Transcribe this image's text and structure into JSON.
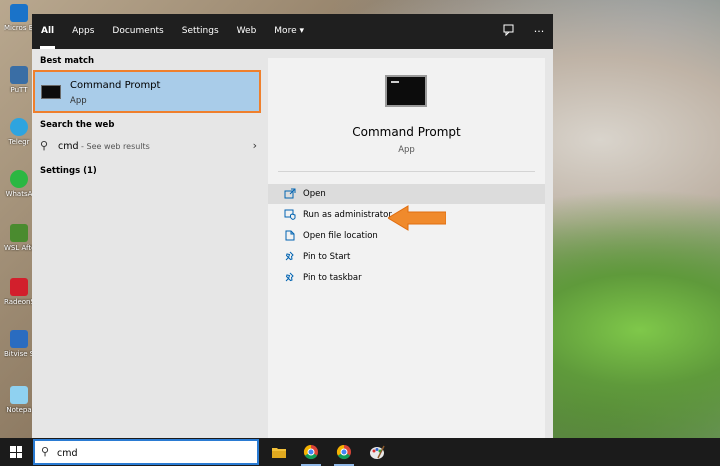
{
  "desktop_icons": [
    {
      "label": "Micros Edge",
      "color": "#1a73c9"
    },
    {
      "label": "PuTT",
      "color": "#3a6ea5"
    },
    {
      "label": "Telegr",
      "color": "#2ea4df"
    },
    {
      "label": "WhatsA",
      "color": "#2bb742"
    },
    {
      "label": "WSL Afterbu",
      "color": "#4a8b2f"
    },
    {
      "label": "RadeonS",
      "color": "#d21f2c"
    },
    {
      "label": "Bitvise SSH Client",
      "color": "#2a6cc0"
    },
    {
      "label": "Notepa",
      "color": "#8fd1f0"
    }
  ],
  "start": {
    "tabs": [
      "All",
      "Apps",
      "Documents",
      "Settings",
      "Web",
      "More ▾"
    ],
    "active_tab": "All",
    "topbar_icons": [
      "feedback-icon",
      "more-options-icon"
    ],
    "best_match_heading": "Best match",
    "best_match": {
      "name": "Command Prompt",
      "type": "App"
    },
    "search_web_heading": "Search the web",
    "web_result": {
      "query": "cmd",
      "hint": " - See web results"
    },
    "settings_heading": "Settings (1)",
    "preview": {
      "title": "Command Prompt",
      "subtitle": "App",
      "actions": [
        {
          "label": "Open",
          "icon": "open-icon",
          "highlight": true
        },
        {
          "label": "Run as administrator",
          "icon": "run-as-admin-icon",
          "highlight": false
        },
        {
          "label": "Open file location",
          "icon": "file-location-icon",
          "highlight": false
        },
        {
          "label": "Pin to Start",
          "icon": "pin-icon",
          "highlight": false
        },
        {
          "label": "Pin to taskbar",
          "icon": "pin-icon",
          "highlight": false
        }
      ]
    }
  },
  "taskbar": {
    "search_value": "cmd",
    "apps": [
      "file-explorer-icon",
      "chrome-icon",
      "chrome-icon",
      "paint-icon"
    ]
  },
  "colors": {
    "accent_orange": "#ef7f2c",
    "selection_blue": "#a9cce9",
    "action_blue": "#0063b1"
  }
}
